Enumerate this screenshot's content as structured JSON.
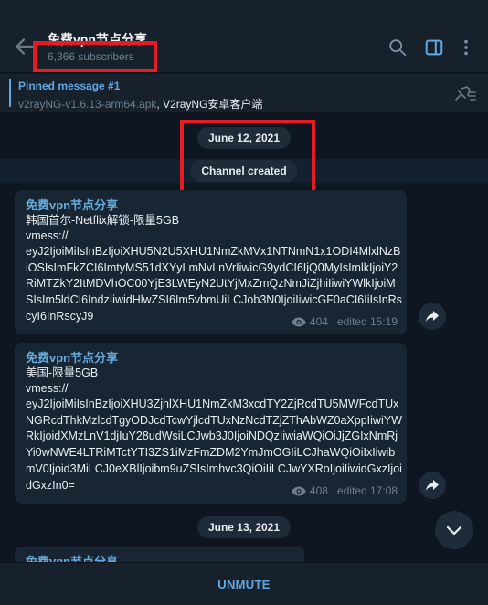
{
  "header": {
    "title": "免费vpn节点分享",
    "subscribers": "6,366 subscribers"
  },
  "pinned": {
    "label": "Pinned message #1",
    "file": "v2rayNG-v1.6.13-arm64.apk",
    "text": ", V2rayNG安卓客户端"
  },
  "dates": {
    "first": "June 12, 2021",
    "second": "June 13, 2021"
  },
  "service": {
    "text": "Channel created"
  },
  "messages": [
    {
      "sender": "免费vpn节点分享",
      "line1": "韩国首尔-Netflix解锁-限量5GB",
      "line2": "vmess://",
      "body": "eyJ2IjoiMiIsInBzIjoiXHU5N2U5XHU1NmZkMVx1NTNmN1x1ODI4MlxlNzBiOSIsImFkZCI6ImtyMS51dXYyLmNvLnVrIiwicG9ydCI6IjQ0MyIsImlkIjoiY2RiMTZkY2ItMDVhOC00YjE3LWEyN2UtYjMxZmQzNmJiZjhiIiwiYWlkIjoiMSIsIm5ldCI6IndzIiwidHlwZSI6Im5vbmUiLCJob3N0IjoiIiwicGF0aCI6IiIsInRscyI6InRscyJ9",
      "views": "404",
      "time": "edited 15:19"
    },
    {
      "sender": "免费vpn节点分享",
      "line1": "美国-限量5GB",
      "line2": "vmess://",
      "body": "eyJ2IjoiMiIsInBzIjoiXHU3ZjhlXHU1NmZkM3xcdTY2ZjRcdTU5MWFcdTUxNGRcdThkMzlcdTgyODJcdTcwYjlcdTUxNzNcdTZjZThAbWZ0aXppIiwiYWRkIjoidXMzLnV1djIuY28udWsiLCJwb3J0IjoiNDQzIiwiaWQiOiJjZGIxNmRjYi0wNWE4LTRiMTctYTI3ZS1iMzFmZDM2YmJmOGIiLCJhaWQiOiIxIiwibmV0Ijoid3MiLCJ0eXBlIjoibm9uZSIsImhvc3QiOiIiLCJwYXRoIjoiIiwidGxzIjoidGxzIn0=",
      "views": "408",
      "time": "edited 17:08"
    },
    {
      "sender": "免费vpn节点分享"
    }
  ],
  "footer": {
    "unmute": "UNMUTE"
  },
  "colors": {
    "background": "#0e1621",
    "header": "#17212b",
    "bubble": "#182533",
    "accent": "#5fa8e4",
    "highlight": "#e51c23"
  },
  "icons": [
    "back-arrow-icon",
    "search-icon",
    "sidebar-icon",
    "more-icon",
    "unpin-list-icon",
    "eye-icon",
    "share-icon",
    "chevron-down-icon"
  ]
}
